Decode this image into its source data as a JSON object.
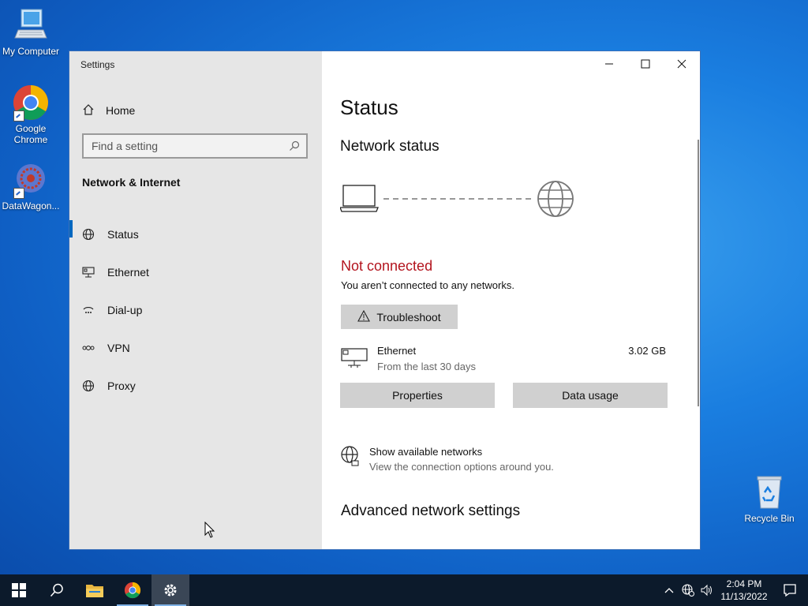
{
  "desktop": {
    "icons": [
      {
        "label": "My Computer"
      },
      {
        "label": "Google Chrome"
      },
      {
        "label": "DataWagon..."
      },
      {
        "label": "Recycle Bin"
      }
    ]
  },
  "window": {
    "title": "Settings",
    "sidebar": {
      "home_label": "Home",
      "search_placeholder": "Find a setting",
      "section": "Network & Internet",
      "items": [
        {
          "label": "Status",
          "icon": "status-icon",
          "active": true
        },
        {
          "label": "Ethernet",
          "icon": "ethernet-icon"
        },
        {
          "label": "Dial-up",
          "icon": "dialup-icon"
        },
        {
          "label": "VPN",
          "icon": "vpn-icon"
        },
        {
          "label": "Proxy",
          "icon": "globe-icon"
        }
      ]
    },
    "content": {
      "title": "Status",
      "network_status_heading": "Network status",
      "status_text": "Not connected",
      "status_desc": "You aren’t connected to any networks.",
      "troubleshoot_label": "Troubleshoot",
      "ethernet": {
        "name": "Ethernet",
        "period": "From the last 30 days",
        "usage": "3.02 GB"
      },
      "properties_label": "Properties",
      "data_usage_label": "Data usage",
      "show_networks": {
        "title": "Show available networks",
        "subtitle": "View the connection options around you."
      },
      "advanced_heading": "Advanced network settings"
    }
  },
  "taskbar": {
    "time": "2:04 PM",
    "date": "11/13/2022"
  },
  "colors": {
    "accent": "#0067c0",
    "error": "#b3141e",
    "taskbar": "#0c1a2b"
  }
}
